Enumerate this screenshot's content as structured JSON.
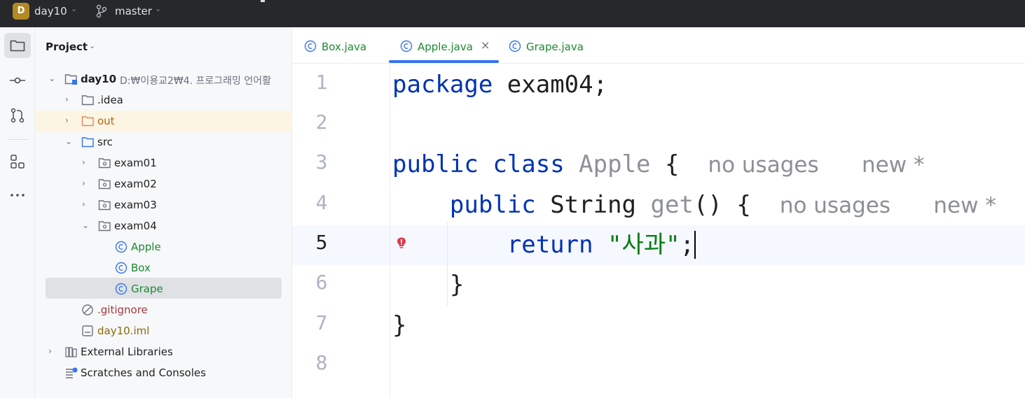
{
  "titlebar": {
    "project_badge": "D",
    "project_name": "day10",
    "branch": "master"
  },
  "activity_bar": {
    "items": [
      "project-folder-icon",
      "commit-icon",
      "pull-requests-icon",
      "structure-icon",
      "more-icon"
    ]
  },
  "project_panel": {
    "title": "Project",
    "tree": [
      {
        "label": "day10",
        "path": "D:₩이용교2₩4. 프로그래밍 언어활"
      },
      {
        "label": ".idea"
      },
      {
        "label": "out"
      },
      {
        "label": "src"
      },
      {
        "label": "exam01"
      },
      {
        "label": "exam02"
      },
      {
        "label": "exam03"
      },
      {
        "label": "exam04"
      },
      {
        "label": "Apple"
      },
      {
        "label": "Box"
      },
      {
        "label": "Grape"
      },
      {
        "label": ".gitignore"
      },
      {
        "label": "day10.iml"
      },
      {
        "label": "External Libraries"
      },
      {
        "label": "Scratches and Consoles"
      }
    ]
  },
  "tabs": [
    {
      "label": "Box.java"
    },
    {
      "label": "Apple.java",
      "active": true,
      "close": "×"
    },
    {
      "label": "Grape.java"
    }
  ],
  "editor": {
    "line_numbers": [
      "1",
      "2",
      "3",
      "4",
      "5",
      "6",
      "7",
      "8"
    ],
    "current_line": "5",
    "tokens": {
      "package_kw": "package",
      "package_name": "exam04;",
      "public_kw": "public",
      "class_kw": "class",
      "class_name": "Apple",
      "open_brace": "{",
      "string_type": "String",
      "method_name": "get",
      "parens": "()",
      "return_kw": "return",
      "string_literal": "\"사과\"",
      "semicolon": ";",
      "close_brace": "}"
    },
    "hints": {
      "usages": "no usages",
      "author": "new *"
    }
  },
  "colors": {
    "keyword": "#0033b3",
    "string": "#067d17",
    "java_file": "#1b8a2f",
    "accent": "#3574f0"
  }
}
